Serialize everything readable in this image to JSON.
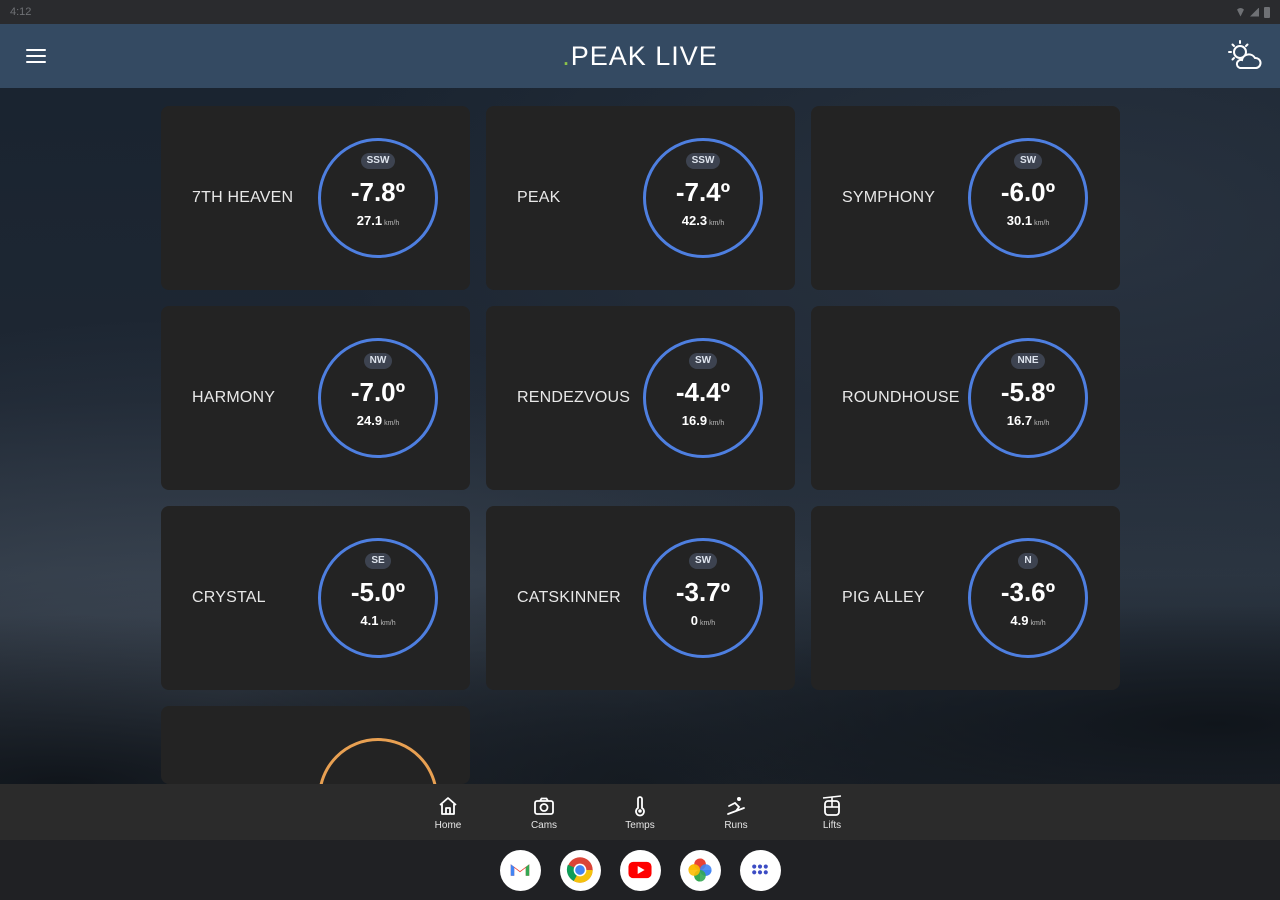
{
  "status_bar": {
    "time": "4:12"
  },
  "app_bar": {
    "title_dot": ".",
    "title": "PEAK LIVE"
  },
  "stations": [
    {
      "name": "7TH HEAVEN",
      "direction": "SSW",
      "temp": "-7.8º",
      "wind": "27.1",
      "unit": "km/h"
    },
    {
      "name": "PEAK",
      "direction": "SSW",
      "temp": "-7.4º",
      "wind": "42.3",
      "unit": "km/h"
    },
    {
      "name": "SYMPHONY",
      "direction": "SW",
      "temp": "-6.0º",
      "wind": "30.1",
      "unit": "km/h"
    },
    {
      "name": "HARMONY",
      "direction": "NW",
      "temp": "-7.0º",
      "wind": "24.9",
      "unit": "km/h"
    },
    {
      "name": "RENDEZVOUS",
      "direction": "SW",
      "temp": "-4.4º",
      "wind": "16.9",
      "unit": "km/h"
    },
    {
      "name": "ROUNDHOUSE",
      "direction": "NNE",
      "temp": "-5.8º",
      "wind": "16.7",
      "unit": "km/h"
    },
    {
      "name": "CRYSTAL",
      "direction": "SE",
      "temp": "-5.0º",
      "wind": "4.1",
      "unit": "km/h"
    },
    {
      "name": "CATSKINNER",
      "direction": "SW",
      "temp": "-3.7º",
      "wind": "0",
      "unit": "km/h"
    },
    {
      "name": "PIG ALLEY",
      "direction": "N",
      "temp": "-3.6º",
      "wind": "4.9",
      "unit": "km/h"
    }
  ],
  "bottom_nav": [
    {
      "label": "Home",
      "icon": "home-icon"
    },
    {
      "label": "Cams",
      "icon": "camera-icon"
    },
    {
      "label": "Temps",
      "icon": "thermometer-icon"
    },
    {
      "label": "Runs",
      "icon": "skier-icon"
    },
    {
      "label": "Lifts",
      "icon": "gondola-icon"
    }
  ],
  "dock": [
    {
      "icon": "gmail-icon"
    },
    {
      "icon": "chrome-icon"
    },
    {
      "icon": "youtube-icon"
    },
    {
      "icon": "photos-icon"
    },
    {
      "icon": "app-drawer-icon"
    }
  ],
  "colors": {
    "app_bar": "#344a62",
    "gauge_ring": "#4e7fe0",
    "gauge_ring_alt": "#e8a052",
    "title_dot": "#8bc34a"
  }
}
